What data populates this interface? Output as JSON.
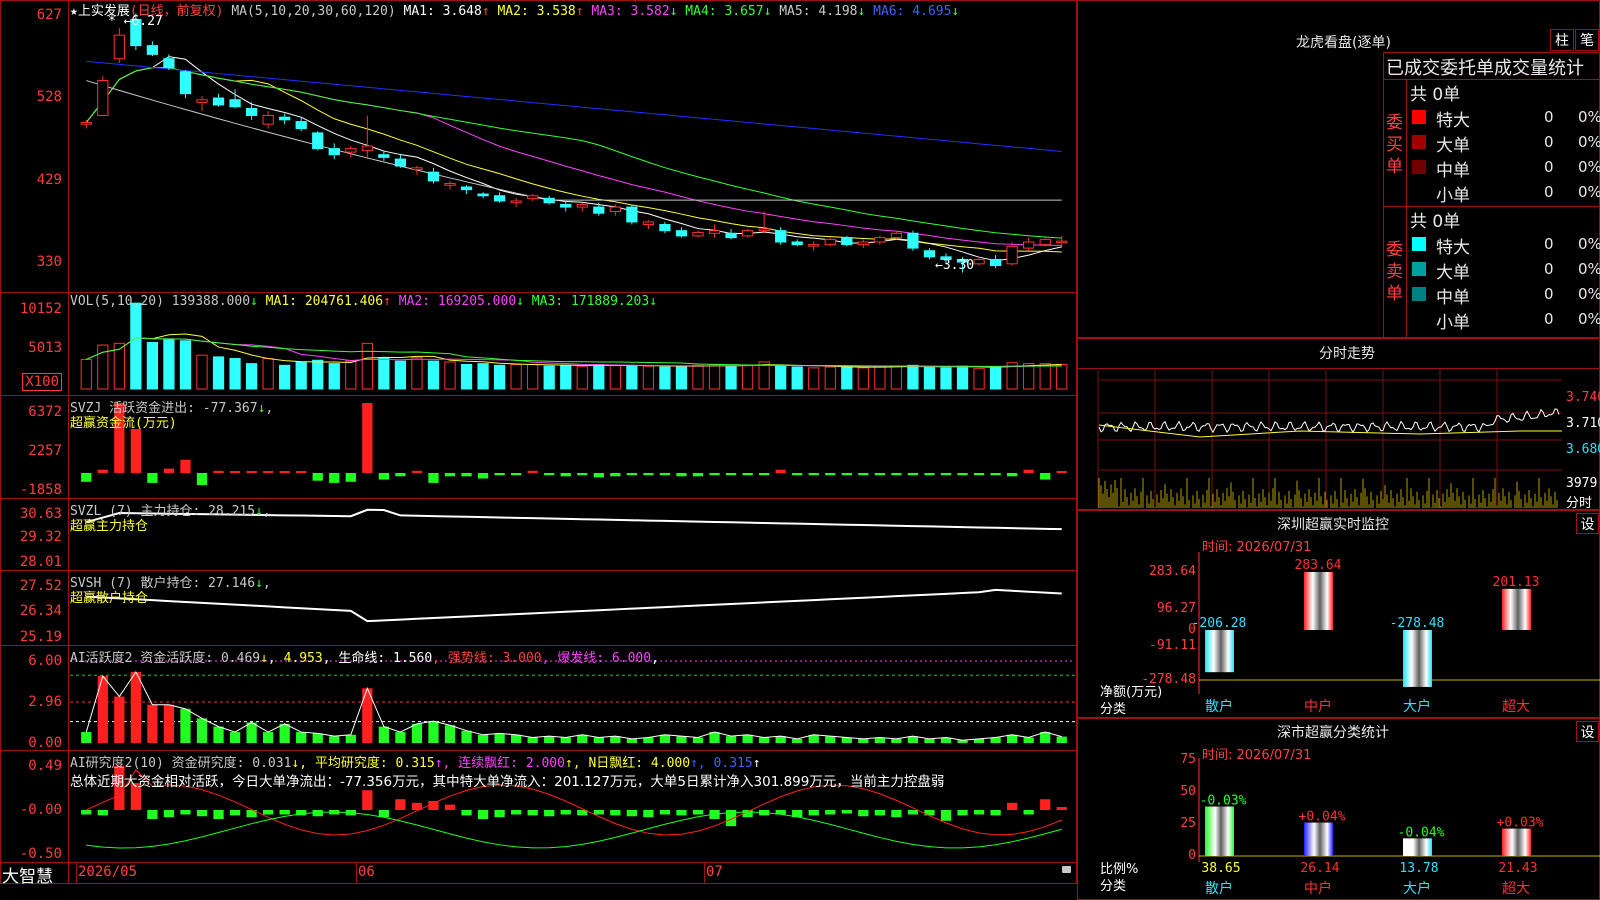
{
  "stock": {
    "name": "上实发展",
    "mode": "(日线，前复权)"
  },
  "ma_row": {
    "prefix": "MA(5,10,20,30,60,120)",
    "items": [
      {
        "label": "MA1: 3.648",
        "arrow": "↑",
        "color": "#ffffff"
      },
      {
        "label": "MA2: 3.538",
        "arrow": "↑",
        "color": "#ffff33"
      },
      {
        "label": "MA3: 3.582",
        "arrow": "↓",
        "color": "#ff40ff"
      },
      {
        "label": "MA4: 3.657",
        "arrow": "↓",
        "color": "#33ff33"
      },
      {
        "label": "MA5: 4.198",
        "arrow": "↓",
        "color": "#c8c8c8"
      },
      {
        "label": "MA6: 4.695",
        "arrow": "↓",
        "color": "#4060ff"
      }
    ]
  },
  "price_axis": [
    "627",
    "528",
    "429",
    "330"
  ],
  "price_marks": {
    "high": "6.27",
    "low": "3.30"
  },
  "vol_row": {
    "prefix": "VOL(5,10,20)",
    "items": [
      {
        "label": "139388.000",
        "arrow": "↓",
        "color": "#c8c8c8"
      },
      {
        "label": "MA1: 204761.406",
        "arrow": "↑",
        "color": "#ffff33"
      },
      {
        "label": "MA2: 169205.000",
        "arrow": "↓",
        "color": "#ff40ff"
      },
      {
        "label": "MA3: 171889.203",
        "arrow": "↓",
        "color": "#33ff33"
      }
    ]
  },
  "vol_axis": [
    "10152",
    "5013",
    "X100"
  ],
  "svzj": {
    "title": "SVZJ  活跃资金进出: -77.367",
    "arrow": "↓",
    "sub": "超赢资金流(万元)",
    "axis": [
      "6372",
      "2257",
      "-1858"
    ]
  },
  "svzl": {
    "title": "SVZL (7) 主力持仓: 28.215",
    "arrow": "↓",
    "comma": ",",
    "sub": "超赢主力持仓",
    "axis": [
      "30.63",
      "29.32",
      "28.01"
    ]
  },
  "svsh": {
    "title": "SVSH (7) 散户持仓: 27.146",
    "arrow": "↓",
    "comma": ",",
    "sub": "超赢散户持仓",
    "axis": [
      "27.52",
      "26.34",
      "25.19"
    ]
  },
  "ai1": {
    "title": "AI活跃度2 资金活跃度: 0.469",
    "items": [
      {
        "label": "↓, 4.953",
        "color": "#ffff33"
      },
      {
        "label": ", 生命线: 1.560",
        "color": "#ffffff"
      },
      {
        "label": ", 强势线: 3.000",
        "color": "#ff4040"
      },
      {
        "label": ", 爆发线: 6.000",
        "color": "#ff40ff"
      },
      {
        "label": ",",
        "color": "#ffffff"
      }
    ],
    "axis": [
      "6.00",
      "2.96",
      "0.00"
    ]
  },
  "ai2": {
    "title": "AI研究度2(10) 资金研究度: 0.031",
    "items": [
      {
        "label": "↓, 平均研究度: 0.315",
        "color": "#ffff33"
      },
      {
        "label": "↑, 连续飘红: 2.000",
        "color": "#ff40ff"
      },
      {
        "label": "↑, N日飘红: 4.000",
        "color": "#ffff33"
      },
      {
        "label": "↑, 0.315",
        "color": "#4060ff"
      },
      {
        "label": "↑",
        "color": "#ffffff"
      }
    ],
    "summary": "总体近期大资金相对活跃，今日大单净流出：-77.356万元，其中特大单净流入：201.127万元，大单5日累计净入301.899万元，当前主力控盘弱",
    "axis": [
      "0.49",
      "-0.00",
      "-0.50"
    ]
  },
  "date_axis": {
    "brand": "大智慧",
    "labels": [
      "2026/05",
      "06",
      "07"
    ]
  },
  "lhb": {
    "title": "龙虎看盘(逐单)",
    "btn_bar": "柱",
    "btn_pen": "笔",
    "header": "已成交委托单成交量统计",
    "buy": {
      "side": "委买单",
      "total": "共 0单",
      "rows": [
        {
          "name": "特大",
          "count": "0",
          "pct": "0%",
          "color": "#ff0000"
        },
        {
          "name": "大单",
          "count": "0",
          "pct": "0%",
          "color": "#a00000"
        },
        {
          "name": "中单",
          "count": "0",
          "pct": "0%",
          "color": "#700000"
        },
        {
          "name": "小单",
          "count": "0",
          "pct": "0%",
          "color": "#000000"
        }
      ]
    },
    "sell": {
      "side": "委卖单",
      "total": "共 0单",
      "rows": [
        {
          "name": "特大",
          "count": "0",
          "pct": "0%",
          "color": "#00ffff"
        },
        {
          "name": "大单",
          "count": "0",
          "pct": "0%",
          "color": "#00a0a0"
        },
        {
          "name": "中单",
          "count": "0",
          "pct": "0%",
          "color": "#008080"
        },
        {
          "name": "小单",
          "count": "0",
          "pct": "0%",
          "color": "#000000"
        }
      ]
    }
  },
  "fenshi": {
    "title": "分时走势",
    "axis": [
      "3.740",
      "3.710",
      "3.680"
    ],
    "vol": "3979",
    "unit": "分时"
  },
  "monitor": {
    "title": "深圳超赢实时监控",
    "time": "时间: 2026/07/31",
    "settings": "设",
    "axis": [
      "283.64",
      "96.27",
      "0",
      "-91.11",
      "-278.48"
    ],
    "ylabel": "净额(万元)",
    "xlabel": "分类",
    "bars": [
      {
        "cat": "散户",
        "value": -206.28,
        "label": "-206.28"
      },
      {
        "cat": "中户",
        "value": 283.64,
        "label": "283.64"
      },
      {
        "cat": "大户",
        "value": -278.48,
        "label": "-278.48"
      },
      {
        "cat": "超大",
        "value": 201.13,
        "label": "201.13"
      }
    ]
  },
  "stats": {
    "title": "深市超赢分类统计",
    "time": "时间: 2026/07/31",
    "settings": "设",
    "axis": [
      "75",
      "50",
      "25",
      "0"
    ],
    "ylabel": "比例%",
    "xlabel": "分类",
    "bars": [
      {
        "cat": "散户",
        "value": 38.65,
        "label": "38.65",
        "chg": "-0.03%"
      },
      {
        "cat": "中户",
        "value": 26.14,
        "label": "26.14",
        "chg": "+0.04%"
      },
      {
        "cat": "大户",
        "value": 13.78,
        "label": "13.78",
        "chg": "-0.04%"
      },
      {
        "cat": "超大",
        "value": 21.43,
        "label": "21.43",
        "chg": "+0.03%"
      }
    ]
  },
  "chart_data": [
    {
      "type": "candlestick",
      "title": "上实发展 (日线，前复权)",
      "ylim": [
        3.1,
        6.4
      ],
      "ohlc": [
        [
          5.0,
          5.05,
          4.95,
          5.02
        ],
        [
          5.1,
          5.55,
          5.1,
          5.5
        ],
        [
          5.75,
          6.1,
          5.7,
          6.02
        ],
        [
          6.2,
          6.27,
          5.85,
          5.9
        ],
        [
          5.9,
          5.95,
          5.78,
          5.8
        ],
        [
          5.75,
          5.8,
          5.62,
          5.65
        ],
        [
          5.6,
          5.62,
          5.3,
          5.35
        ],
        [
          5.25,
          5.32,
          5.15,
          5.28
        ],
        [
          5.3,
          5.35,
          5.2,
          5.22
        ],
        [
          5.28,
          5.4,
          5.18,
          5.2
        ],
        [
          5.18,
          5.25,
          5.05,
          5.1
        ],
        [
          5.0,
          5.15,
          4.95,
          5.1
        ],
        [
          5.08,
          5.12,
          5.0,
          5.05
        ],
        [
          5.03,
          5.08,
          4.92,
          4.95
        ],
        [
          4.9,
          4.92,
          4.7,
          4.72
        ],
        [
          4.72,
          4.78,
          4.6,
          4.65
        ],
        [
          4.68,
          4.75,
          4.62,
          4.72
        ],
        [
          4.7,
          5.1,
          4.6,
          4.75
        ],
        [
          4.65,
          4.7,
          4.58,
          4.62
        ],
        [
          4.6,
          4.65,
          4.5,
          4.52
        ],
        [
          4.48,
          4.52,
          4.42,
          4.5
        ],
        [
          4.45,
          4.5,
          4.32,
          4.35
        ],
        [
          4.3,
          4.35,
          4.25,
          4.32
        ],
        [
          4.28,
          4.3,
          4.2,
          4.25
        ],
        [
          4.2,
          4.22,
          4.15,
          4.18
        ],
        [
          4.18,
          4.22,
          4.1,
          4.12
        ],
        [
          4.1,
          4.15,
          4.05,
          4.12
        ],
        [
          4.15,
          4.2,
          4.12,
          4.18
        ],
        [
          4.15,
          4.18,
          4.08,
          4.1
        ],
        [
          4.08,
          4.12,
          4.0,
          4.05
        ],
        [
          4.05,
          4.1,
          4.0,
          4.08
        ],
        [
          4.05,
          4.1,
          3.95,
          3.98
        ],
        [
          4.0,
          4.08,
          3.95,
          4.05
        ],
        [
          4.05,
          4.08,
          3.85,
          3.88
        ],
        [
          3.85,
          3.9,
          3.8,
          3.88
        ],
        [
          3.85,
          3.88,
          3.75,
          3.78
        ],
        [
          3.78,
          3.82,
          3.7,
          3.72
        ],
        [
          3.72,
          3.78,
          3.7,
          3.76
        ],
        [
          3.75,
          3.85,
          3.7,
          3.78
        ],
        [
          3.75,
          3.8,
          3.68,
          3.7
        ],
        [
          3.72,
          3.8,
          3.7,
          3.78
        ],
        [
          3.78,
          4.0,
          3.75,
          3.8
        ],
        [
          3.78,
          3.82,
          3.62,
          3.65
        ],
        [
          3.65,
          3.68,
          3.6,
          3.62
        ],
        [
          3.62,
          3.66,
          3.55,
          3.62
        ],
        [
          3.62,
          3.7,
          3.6,
          3.68
        ],
        [
          3.7,
          3.72,
          3.6,
          3.62
        ],
        [
          3.62,
          3.68,
          3.58,
          3.65
        ],
        [
          3.65,
          3.72,
          3.62,
          3.7
        ],
        [
          3.7,
          3.78,
          3.68,
          3.75
        ],
        [
          3.75,
          3.78,
          3.55,
          3.58
        ],
        [
          3.55,
          3.58,
          3.45,
          3.48
        ],
        [
          3.48,
          3.52,
          3.4,
          3.45
        ],
        [
          3.45,
          3.48,
          3.3,
          3.42
        ],
        [
          3.4,
          3.48,
          3.38,
          3.45
        ],
        [
          3.45,
          3.5,
          3.35,
          3.38
        ],
        [
          3.4,
          3.65,
          3.38,
          3.6
        ],
        [
          3.58,
          3.7,
          3.55,
          3.65
        ],
        [
          3.62,
          3.7,
          3.6,
          3.68
        ],
        [
          3.65,
          3.72,
          3.6,
          3.66
        ]
      ]
    },
    {
      "type": "bar",
      "title": "VOL(5,10,20)",
      "values": [
        3500,
        5200,
        5400,
        10152,
        5500,
        5800,
        5700,
        4000,
        3800,
        3600,
        3000,
        3600,
        2800,
        3200,
        3400,
        3000,
        3300,
        5400,
        3600,
        3300,
        3700,
        3300,
        3200,
        2900,
        3000,
        2800,
        2900,
        2900,
        2700,
        2800,
        2700,
        2900,
        2800,
        2700,
        2700,
        2600,
        2700,
        2800,
        2900,
        2700,
        2800,
        3200,
        2700,
        2600,
        2500,
        2600,
        2700,
        2500,
        2600,
        2700,
        2800,
        2600,
        2500,
        2700,
        2400,
        2600,
        3100,
        3000,
        3000,
        2900
      ]
    },
    {
      "type": "bar",
      "title": "SVZJ 超赢资金流(万元)",
      "values": [
        -800,
        300,
        6372,
        4000,
        -900,
        400,
        1200,
        -1100,
        200,
        100,
        100,
        100,
        150,
        100,
        -700,
        -900,
        -800,
        6372,
        -600,
        -300,
        200,
        -900,
        -300,
        -300,
        -500,
        -200,
        -200,
        200,
        -200,
        -300,
        -200,
        -400,
        -300,
        -200,
        -200,
        -200,
        -300,
        -300,
        -200,
        -200,
        -200,
        -200,
        300,
        -200,
        -200,
        -200,
        -200,
        -200,
        -200,
        -200,
        -200,
        -200,
        -200,
        -200,
        -200,
        -200,
        -300,
        300,
        -600,
        100
      ]
    },
    {
      "type": "bar",
      "title": "AI活跃度2",
      "values": [
        0.8,
        4.9,
        3.4,
        5.2,
        2.8,
        2.8,
        2.5,
        1.8,
        1.2,
        0.8,
        1.5,
        0.8,
        1.4,
        0.8,
        0.7,
        0.5,
        0.6,
        4.0,
        1.2,
        0.8,
        1.4,
        1.6,
        1.3,
        0.9,
        0.6,
        0.7,
        0.6,
        0.4,
        0.5,
        0.4,
        0.6,
        0.4,
        0.5,
        0.3,
        0.4,
        0.6,
        0.5,
        0.4,
        0.8,
        0.5,
        0.6,
        0.4,
        0.5,
        0.3,
        0.6,
        0.5,
        0.4,
        0.3,
        0.4,
        0.3,
        0.5,
        0.3,
        0.4,
        0.2,
        0.3,
        0.4,
        0.6,
        0.4,
        0.8,
        0.469
      ]
    },
    {
      "type": "bar",
      "title": "AI研究度2(10)",
      "values": [
        -0.05,
        -0.06,
        0.49,
        0.3,
        -0.1,
        -0.08,
        -0.05,
        -0.07,
        -0.1,
        -0.06,
        -0.08,
        -0.05,
        -0.05,
        -0.06,
        -0.07,
        -0.05,
        -0.06,
        0.22,
        -0.08,
        0.12,
        0.08,
        0.1,
        0.06,
        -0.06,
        -0.1,
        -0.08,
        -0.05,
        -0.06,
        -0.07,
        -0.05,
        -0.06,
        -0.05,
        -0.06,
        -0.07,
        -0.08,
        -0.05,
        -0.06,
        -0.05,
        -0.1,
        -0.18,
        -0.08,
        -0.06,
        -0.05,
        -0.08,
        -0.06,
        -0.05,
        -0.04,
        -0.07,
        -0.06,
        -0.08,
        -0.05,
        -0.06,
        -0.12,
        -0.06,
        -0.05,
        -0.06,
        0.08,
        -0.05,
        0.12,
        0.031
      ]
    }
  ]
}
